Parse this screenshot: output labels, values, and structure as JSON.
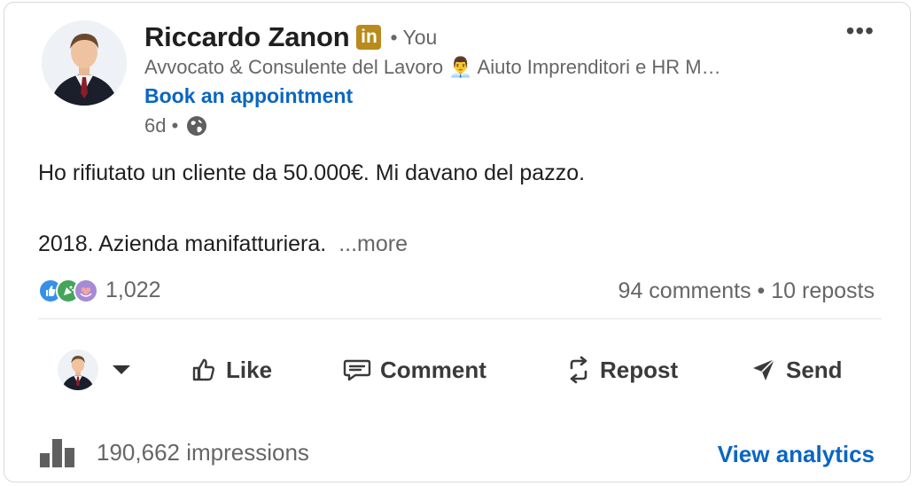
{
  "author": {
    "name": "Riccardo Zanon",
    "badge": "in",
    "relation": "• You",
    "headline": "Avvocato & Consulente del Lavoro 👨‍💼 Aiuto Imprenditori e HR M…",
    "cta": "Book an appointment",
    "time": "6d •",
    "visibility_icon": "globe-icon"
  },
  "post": {
    "line1": "Ho rifiutato un cliente da 50.000€. Mi davano del pazzo.",
    "line2": "2018. Azienda manifatturiera.",
    "more": "...more"
  },
  "social": {
    "reactions_count": "1,022",
    "reaction_icons": [
      "like-icon",
      "celebrate-icon",
      "support-icon"
    ],
    "comments_reposts": "94 comments • 10 reposts"
  },
  "actions": {
    "like": "Like",
    "comment": "Comment",
    "repost": "Repost",
    "send": "Send"
  },
  "footer": {
    "impressions": "190,662 impressions",
    "analytics": "View analytics"
  },
  "colors": {
    "link": "#0a66c2",
    "badge": "#b98a1c",
    "muted": "#666666"
  }
}
